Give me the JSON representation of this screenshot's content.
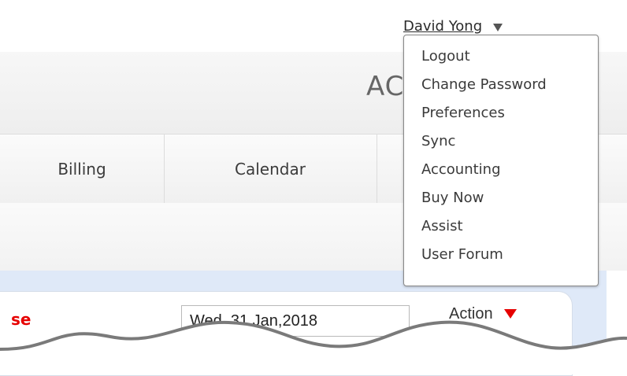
{
  "user": {
    "name": "David Yong",
    "menu": [
      "Logout",
      "Change Password",
      "Preferences",
      "Sync",
      "Accounting",
      "Buy Now",
      "Assist",
      "User Forum"
    ]
  },
  "header": {
    "title": "AC"
  },
  "tabs": [
    "Billing",
    "Calendar"
  ],
  "panel": {
    "label": "se",
    "date_value": "Wed, 31 Jan,2018",
    "action_label": "Action"
  },
  "colors": {
    "accent_red": "#e60000",
    "panel_bg": "#dfe9f8"
  }
}
